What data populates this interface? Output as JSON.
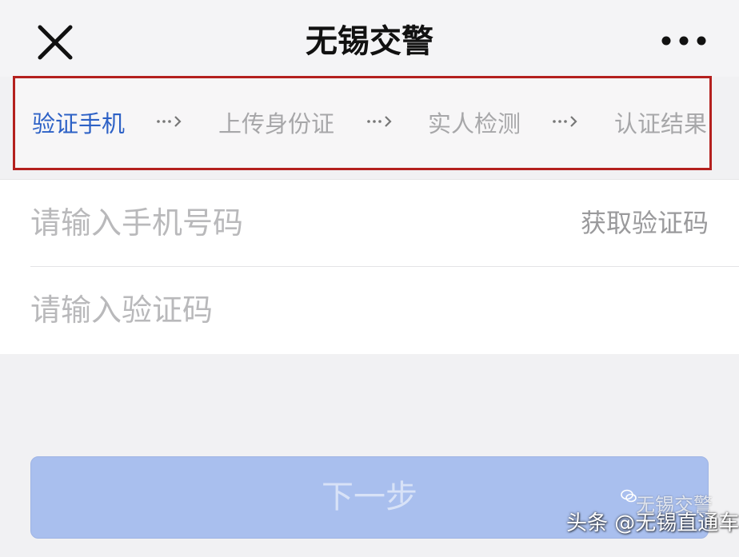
{
  "header": {
    "title": "无锡交警",
    "close_icon": "close-icon",
    "more_icon": "more-icon"
  },
  "steps": [
    {
      "label": "验证手机",
      "active": true
    },
    {
      "label": "上传身份证",
      "active": false
    },
    {
      "label": "实人检测",
      "active": false
    },
    {
      "label": "认证结果",
      "active": false
    }
  ],
  "step_separator": "···›",
  "form": {
    "phone_placeholder": "请输入手机号码",
    "get_code_label": "获取验证码",
    "code_placeholder": "请输入验证码"
  },
  "next_button": {
    "label": "下一步"
  },
  "watermark": {
    "primary": "头条 @无锡直通车",
    "secondary": "无锡交警"
  },
  "colors": {
    "accent": "#2d61c6",
    "highlight_box": "#b4201e",
    "button_bg": "#a9bfee"
  }
}
